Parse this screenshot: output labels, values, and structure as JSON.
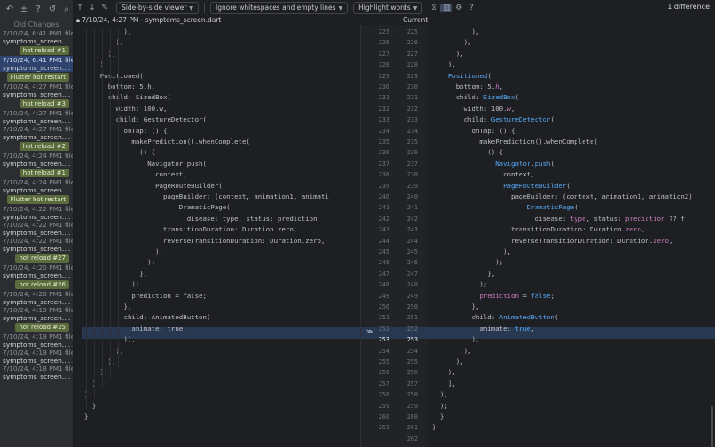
{
  "toolbar": {
    "viewer_mode": "Side-by-side viewer",
    "whitespace_mode": "Ignore whitespaces and empty lines",
    "highlight_mode": "Highlight words",
    "difference_count": "1 difference"
  },
  "history": {
    "title": "Old Changes",
    "entries": [
      {
        "type": "entry",
        "date": "7/10/24, 6:41 PM",
        "suffix": "1 file",
        "file": "symptoms_screen...."
      },
      {
        "type": "label",
        "text": "hot reload #1"
      },
      {
        "type": "entry",
        "date": "7/10/24, 6:41 PM",
        "suffix": "1 file",
        "file": "symptoms_screen....",
        "selected": true
      },
      {
        "type": "label",
        "text": "Flutter hot restart"
      },
      {
        "type": "entry",
        "date": "7/10/24, 4:27 PM",
        "suffix": "1 file",
        "file": "symptoms_screen...."
      },
      {
        "type": "label",
        "text": "hot reload #3"
      },
      {
        "type": "entry",
        "date": "7/10/24, 4:27 PM",
        "suffix": "1 file",
        "file": "symptoms_screen...."
      },
      {
        "type": "entry",
        "date": "7/10/24, 4:27 PM",
        "suffix": "1 file",
        "file": "symptoms_screen...."
      },
      {
        "type": "label",
        "text": "hot reload #2"
      },
      {
        "type": "entry",
        "date": "7/10/24, 4:24 PM",
        "suffix": "1 file",
        "file": "symptoms_screen...."
      },
      {
        "type": "label",
        "text": "hot reload #1"
      },
      {
        "type": "entry",
        "date": "7/10/24, 4:24 PM",
        "suffix": "1 file",
        "file": "symptoms_screen...."
      },
      {
        "type": "label",
        "text": "Flutter hot restart"
      },
      {
        "type": "entry",
        "date": "7/10/24, 4:22 PM",
        "suffix": "1 file",
        "file": "symptoms_screen...."
      },
      {
        "type": "entry",
        "date": "7/10/24, 4:22 PM",
        "suffix": "1 file",
        "file": "symptoms_screen...."
      },
      {
        "type": "entry",
        "date": "7/10/24, 4:22 PM",
        "suffix": "1 file",
        "file": "symptoms_screen...."
      },
      {
        "type": "label",
        "text": "hot reload #27"
      },
      {
        "type": "entry",
        "date": "7/10/24, 4:20 PM",
        "suffix": "1 file",
        "file": "symptoms_screen...."
      },
      {
        "type": "label",
        "text": "hot reload #26"
      },
      {
        "type": "entry",
        "date": "7/10/24, 4:20 PM",
        "suffix": "1 file",
        "file": "symptoms_screen...."
      },
      {
        "type": "entry",
        "date": "7/10/24, 4:19 PM",
        "suffix": "1 file",
        "file": "symptoms_screen...."
      },
      {
        "type": "label",
        "text": "hot reload #25"
      },
      {
        "type": "entry",
        "date": "7/10/24, 4:19 PM",
        "suffix": "1 file",
        "file": "symptoms_screen...."
      },
      {
        "type": "entry",
        "date": "7/10/24, 4:19 PM",
        "suffix": "1 file",
        "file": "symptoms_screen...."
      },
      {
        "type": "entry",
        "date": "7/10/24, 4:18 PM",
        "suffix": "1 file",
        "file": "symptoms_screen...."
      }
    ]
  },
  "left_header": "7/10/24, 4:27 PM - symptoms_screen.dart",
  "right_header": "Current",
  "line_numbers_left": [
    "225",
    "226",
    "227",
    "228",
    "229",
    "230",
    "231",
    "232",
    "233",
    "234",
    "235",
    "236",
    "237",
    "238",
    "239",
    "240",
    "241",
    "242",
    "243",
    "244",
    "245",
    "246",
    "247",
    "248",
    "249",
    "250",
    "251",
    "252",
    "253",
    "254",
    "255",
    "256",
    "257",
    "258",
    "259",
    "260",
    "261"
  ],
  "line_numbers_right": [
    "225",
    "226",
    "227",
    "228",
    "229",
    "230",
    "231",
    "232",
    "233",
    "234",
    "235",
    "236",
    "237",
    "238",
    "239",
    "240",
    "241",
    "242",
    "243",
    "244",
    "245",
    "246",
    "247",
    "248",
    "249",
    "250",
    "251",
    "252",
    "253",
    "254",
    "255",
    "256",
    "257",
    "258",
    "259",
    "260",
    "261",
    "262"
  ],
  "left_code": [
    "          ),",
    "        ),",
    "      ),",
    "    ),",
    "    Positioned(",
    "      bottom: 5.h,",
    "      child: SizedBox(",
    "        width: 100.w,",
    "        child: GestureDetector(",
    "          onTap: () {",
    "            makePrediction().whenComplete(",
    "              () {",
    "                Navigator.push(",
    "                  context,",
    "                  PageRouteBuilder(",
    "                    pageBuilder: (context, animation1, animati",
    "                        DramaticPage(",
    "                          disease: type, status: prediction",
    "                    transitionDuration: Duration.zero,",
    "                    reverseTransitionDuration: Duration.zero,",
    "                  ),",
    "                );",
    "              },",
    "            );",
    "            prediction = false;",
    "          },",
    "          child: AnimatedButton(",
    "            animate: true,",
    "          )),",
    "        ),",
    "      ),",
    "    ],",
    "  ),",
    ");",
    "  }",
    "}"
  ],
  "right_code": [
    "          ),",
    "        ),",
    "      ),",
    "    ),",
    "    Positioned(",
    "      bottom: 5.h,",
    "      child: SizedBox(",
    "        width: 100.w,",
    "        child: GestureDetector(",
    "          onTap: () {",
    "            makePrediction().whenComplete(",
    "              () {",
    "                Navigator.push(",
    "                  context,",
    "                  PageRouteBuilder(",
    "                    pageBuilder: (context, animation1, animation2)",
    "                        DramaticPage(",
    "                          disease: type, status: prediction ?? f",
    "                    transitionDuration: Duration.zero,",
    "                    reverseTransitionDuration: Duration.zero,",
    "                  ),",
    "                );",
    "              },",
    "            );",
    "            prediction = false;",
    "          },",
    "          child: AnimatedButton(",
    "            animate: true,",
    "          ),",
    "        ),",
    "      ),",
    "    ),",
    "    ],",
    "  ),",
    "  );",
    "  }",
    "}"
  ]
}
